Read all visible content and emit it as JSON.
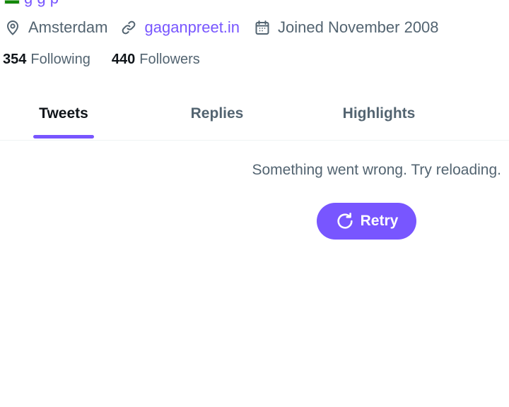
{
  "profile": {
    "website_fragment": "g g   p",
    "location": "Amsterdam",
    "website": "gaganpreet.in",
    "joined": "Joined November 2008",
    "following_count": "354",
    "following_label": "Following",
    "followers_count": "440",
    "followers_label": "Followers"
  },
  "tabs": [
    {
      "label": "Tweets",
      "active": true
    },
    {
      "label": "Replies",
      "active": false
    },
    {
      "label": "Highlights",
      "active": false
    }
  ],
  "error": {
    "message": "Something went wrong. Try reloading.",
    "retry_label": "Retry"
  },
  "icons": {
    "location": "map-pin-icon",
    "website": "link-icon",
    "joined": "calendar-icon",
    "retry": "refresh-icon"
  },
  "colors": {
    "accent": "#7856ff",
    "secondary_text": "#536471",
    "primary_text": "#0f1419"
  }
}
